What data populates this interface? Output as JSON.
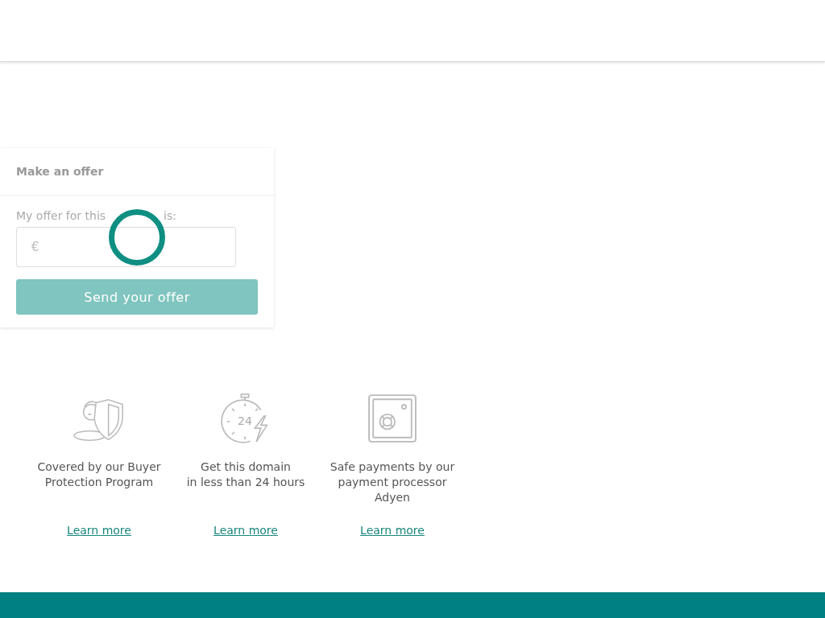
{
  "offer_card": {
    "title": "Make an offer",
    "field_label_parts": [
      "My offer for this",
      "is:"
    ],
    "currency": "€",
    "button": "Send your offer",
    "loading": true
  },
  "features": [
    {
      "kind": "shield",
      "text": "Covered by our Buyer\nProtection Program",
      "link": "Learn more"
    },
    {
      "kind": "stopwatch",
      "icon_label": "24",
      "text": "Get this domain\nin less than 24 hours",
      "link": "Learn more"
    },
    {
      "kind": "safe",
      "text": "Safe payments by our\npayment processor\nAdyen",
      "link": "Learn more"
    }
  ]
}
